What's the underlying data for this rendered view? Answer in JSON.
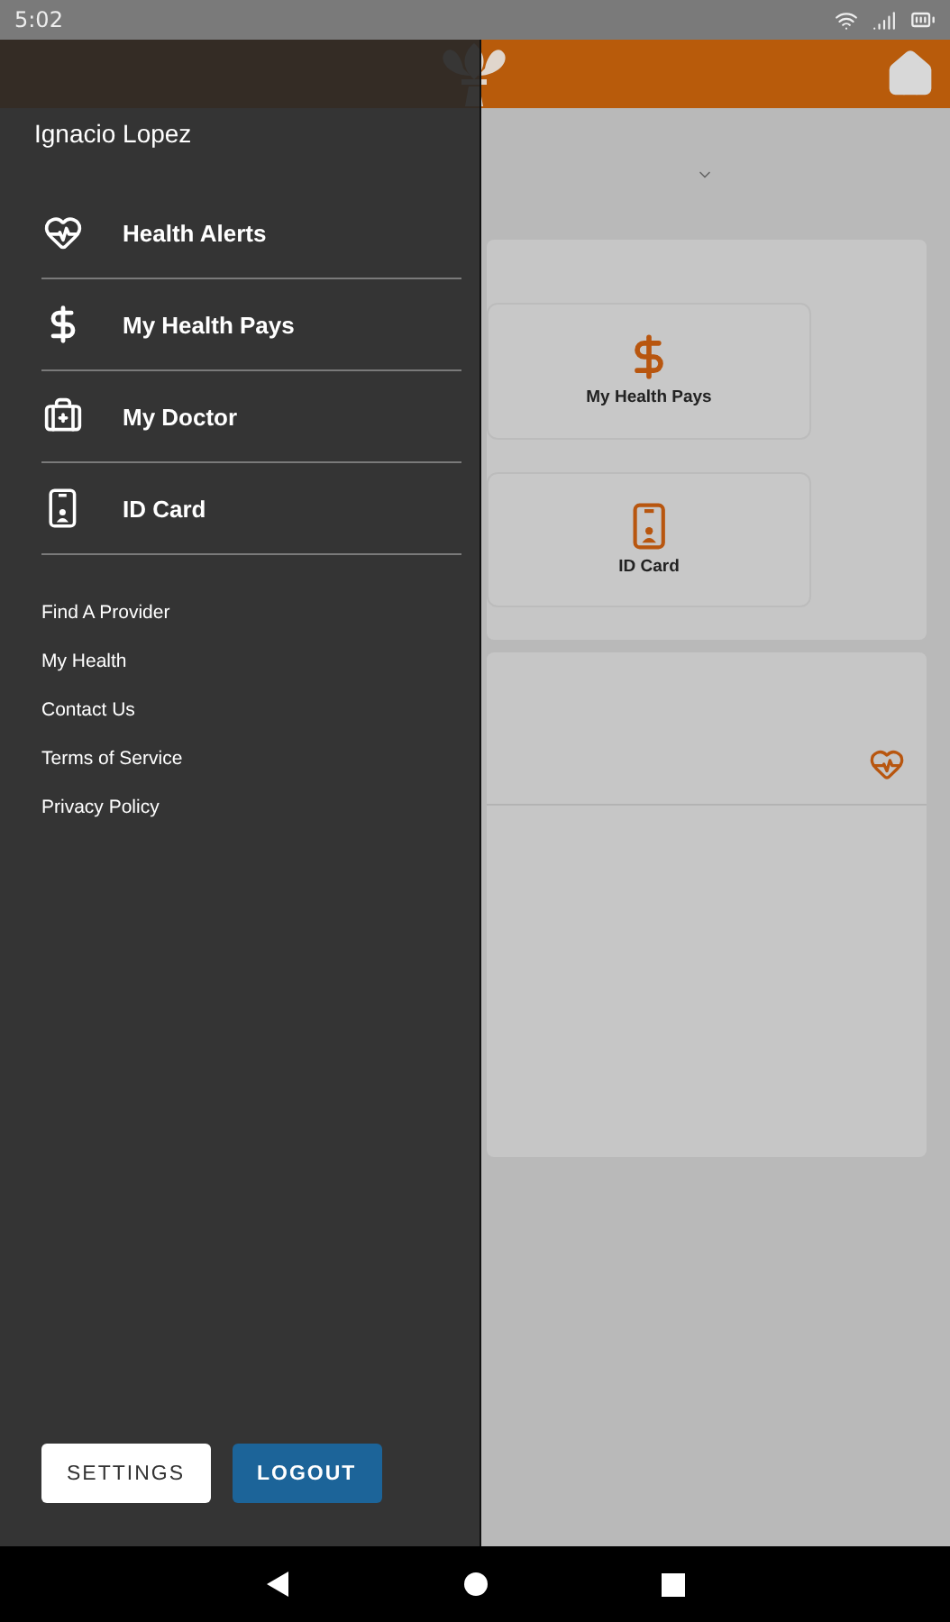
{
  "status_bar": {
    "time": "5:02"
  },
  "drawer": {
    "user_name": "Ignacio Lopez",
    "primary_items": [
      {
        "label": "Health Alerts",
        "kind": "heart"
      },
      {
        "label": "My Health Pays",
        "kind": "dollar"
      },
      {
        "label": "My Doctor",
        "kind": "kit"
      },
      {
        "label": "ID Card",
        "kind": "phone"
      }
    ],
    "secondary_items": [
      "Find A Provider",
      "My Health",
      "Contact Us",
      "Terms of Service",
      "Privacy Policy"
    ],
    "buttons": [
      {
        "label": "SETTINGS",
        "kind": "outlined"
      },
      {
        "label": "LOGOUT",
        "kind": "filled"
      }
    ]
  },
  "main": {
    "tiles": [
      {
        "label": "My Health Pays",
        "kind": "dollar"
      },
      {
        "label": "ID Card",
        "kind": "phone"
      }
    ]
  }
}
